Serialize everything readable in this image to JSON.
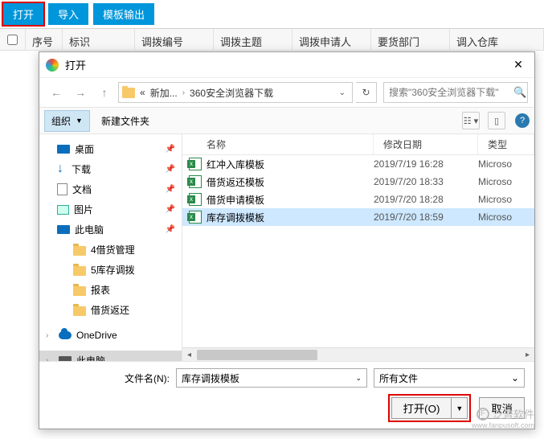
{
  "toolbar": {
    "open": "打开",
    "import": "导入",
    "template_out": "模板输出"
  },
  "grid": {
    "seq": "序号",
    "flag": "标识",
    "code": "调拨编号",
    "subject": "调拨主题",
    "applicant": "调拨申请人",
    "dept": "要货部门",
    "in_wh": "调入仓库"
  },
  "dialog": {
    "title": "打开",
    "path": {
      "ellipsis": "«",
      "folder1": "新加...",
      "sep": "›",
      "folder2": "360安全浏览器下载"
    },
    "search_placeholder": "搜索\"360安全浏览器下载\"",
    "organize": "组织",
    "new_folder": "新建文件夹",
    "tree": {
      "desktop": "桌面",
      "downloads": "下载",
      "documents": "文档",
      "pictures": "图片",
      "this_pc": "此电脑",
      "f1": "4借货管理",
      "f2": "5库存调拨",
      "f3": "报表",
      "f4": "借货返还",
      "onedrive": "OneDrive",
      "this_pc2": "此电脑"
    },
    "cols": {
      "name": "名称",
      "date": "修改日期",
      "type": "类型"
    },
    "files": [
      {
        "name": "红冲入库模板",
        "date": "2019/7/19 16:28",
        "type": "Microso"
      },
      {
        "name": "借货返还模板",
        "date": "2019/7/20 18:33",
        "type": "Microso"
      },
      {
        "name": "借货申请模板",
        "date": "2019/7/20 18:28",
        "type": "Microso"
      },
      {
        "name": "库存调拨模板",
        "date": "2019/7/20 18:59",
        "type": "Microso"
      }
    ],
    "filename_label": "文件名(N):",
    "filename_value": "库存调拨模板",
    "filter": "所有文件",
    "btn_open": "打开(O)",
    "btn_cancel": "取消"
  },
  "watermark": {
    "text": "泛普软件",
    "url": "www.fanpusoft.com"
  }
}
